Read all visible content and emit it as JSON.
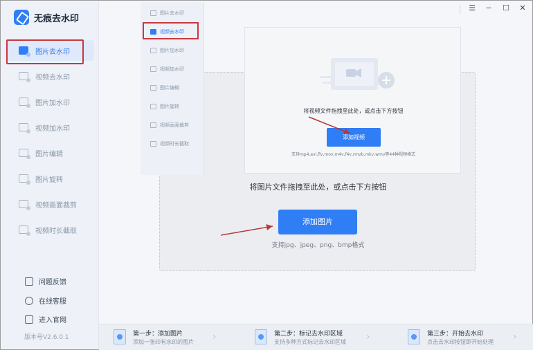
{
  "app": {
    "title": "无痕去水印",
    "version": "版本号V2.6.0.1",
    "accent_color": "#2f7ef5",
    "highlight_color": "#c6383e"
  },
  "window_controls": {
    "menu_icon": "☰",
    "minimize_icon": "−",
    "maximize_icon": "☐",
    "close_icon": "✕"
  },
  "sidebar": {
    "items": [
      {
        "label": "图片去水印",
        "icon": "image-watermark-remove-icon",
        "active": true
      },
      {
        "label": "视频去水印",
        "icon": "video-watermark-remove-icon",
        "active": false
      },
      {
        "label": "图片加水印",
        "icon": "image-watermark-add-icon",
        "active": false
      },
      {
        "label": "视频加水印",
        "icon": "video-watermark-add-icon",
        "active": false
      },
      {
        "label": "图片编辑",
        "icon": "image-edit-icon",
        "active": false
      },
      {
        "label": "图片旋转",
        "icon": "image-rotate-icon",
        "active": false
      },
      {
        "label": "视频画面裁剪",
        "icon": "video-crop-icon",
        "active": false
      },
      {
        "label": "视频时长截取",
        "icon": "video-trim-icon",
        "active": false
      }
    ],
    "footer": [
      {
        "label": "问题反馈",
        "icon": "feedback-icon"
      },
      {
        "label": "在线客服",
        "icon": "support-icon"
      },
      {
        "label": "进入官网",
        "icon": "website-icon"
      }
    ]
  },
  "main": {
    "drop_hint": "将图片文件拖拽至此处，或点击下方按钮",
    "add_button": "添加图片",
    "support_text": "支持jpg、jpeg、png、bmp格式"
  },
  "overlay": {
    "nav_items": [
      {
        "label": "图片去水印",
        "active": false
      },
      {
        "label": "视频去水印",
        "active": true
      },
      {
        "label": "图片加水印",
        "active": false
      },
      {
        "label": "视频加水印",
        "active": false
      },
      {
        "label": "图片编辑",
        "active": false
      },
      {
        "label": "图片旋转",
        "active": false
      },
      {
        "label": "视频画面裁剪",
        "active": false
      },
      {
        "label": "视频时长截取",
        "active": false
      }
    ],
    "drop_hint": "将视频文件拖拽至此处，或点击下方按钮",
    "add_button": "添加视频",
    "support_text": "支持mp4,avi,flv,mov,m4v,f4v,rmvb,mkv,wmv等44种视频格式"
  },
  "steps": [
    {
      "title": "第一步：添加图片",
      "subtitle": "添加一张印有水印的图片"
    },
    {
      "title": "第二步：标记去水印区域",
      "subtitle": "支持多种方式标记去水印区域"
    },
    {
      "title": "第三步：开始去水印",
      "subtitle": "点击去水印按钮即开始处理"
    }
  ]
}
